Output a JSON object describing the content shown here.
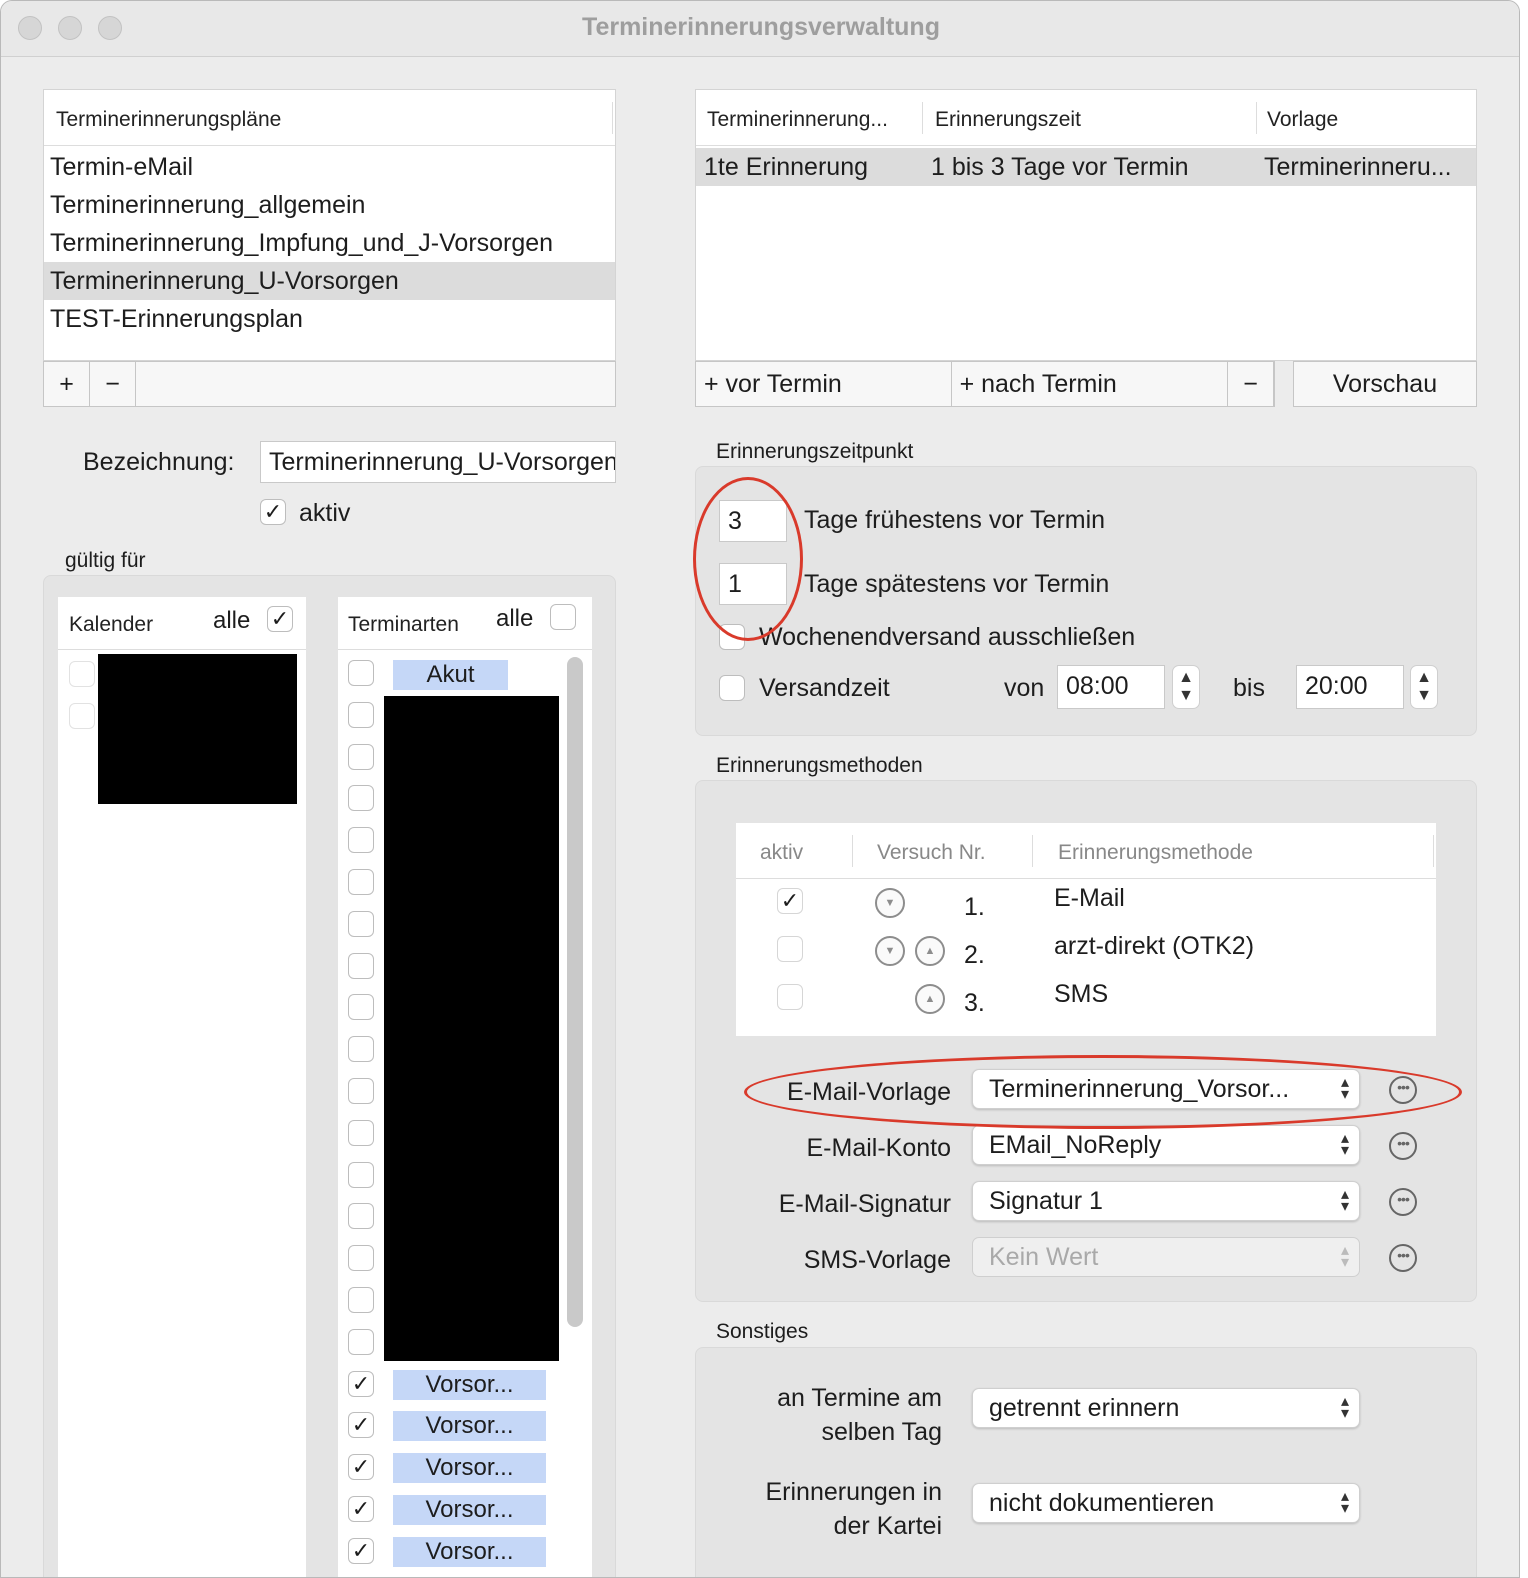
{
  "window": {
    "title": "Terminerinnerungsverwaltung"
  },
  "plans": {
    "header": "Terminerinnerungspläne",
    "items": [
      "Termin-eMail",
      "Terminerinnerung_allgemein",
      "Terminerinnerung_Impfung_und_J-Vorsorgen",
      "Terminerinnerung_U-Vorsorgen",
      "TEST-Erinnerungsplan"
    ],
    "add": "+",
    "remove": "−"
  },
  "name_field": {
    "label": "Bezeichnung:",
    "value": "Terminerinnerung_U-Vorsorgen"
  },
  "active": {
    "label": "aktiv",
    "checked": true
  },
  "valid_for": {
    "label": "gültig für",
    "calendar": {
      "header": "Kalender",
      "all_label": "alle",
      "all_checked": true
    },
    "types": {
      "header": "Terminarten",
      "all_label": "alle",
      "all_checked": false,
      "first_tag": "Akut",
      "checked_tag": "Vorsor..."
    }
  },
  "reminders": {
    "headers": [
      "Terminerinnerung...",
      "Erinnerungszeit",
      "Vorlage"
    ],
    "rows": [
      {
        "name": "1te Erinnerung",
        "time": "1 bis 3 Tage vor Termin",
        "template": "Terminerinneru..."
      }
    ],
    "btn_before": "+ vor Termin",
    "btn_after": "+ nach Termin",
    "btn_remove": "−",
    "btn_preview": "Vorschau"
  },
  "timing": {
    "section": "Erinnerungszeitpunkt",
    "earliest_value": "3",
    "earliest_label": "Tage frühestens vor Termin",
    "latest_value": "1",
    "latest_label": "Tage spätestens vor Termin",
    "weekend_label": "Wochenendversand ausschließen",
    "sendtime_label": "Versandzeit",
    "from_label": "von",
    "from_value": "08:00",
    "to_label": "bis",
    "to_value": "20:00"
  },
  "methods": {
    "section": "Erinnerungsmethoden",
    "headers": [
      "aktiv",
      "Versuch Nr.",
      "Erinnerungsmethode"
    ],
    "rows": [
      {
        "nr": "1.",
        "method": "E-Mail",
        "active": true
      },
      {
        "nr": "2.",
        "method": "arzt-direkt (OTK2)",
        "active": false
      },
      {
        "nr": "3.",
        "method": "SMS",
        "active": false
      }
    ],
    "email_template_label": "E-Mail-Vorlage",
    "email_template_value": "Terminerinnerung_Vorsor...",
    "email_account_label": "E-Mail-Konto",
    "email_account_value": "EMail_NoReply",
    "email_signature_label": "E-Mail-Signatur",
    "email_signature_value": "Signatur 1",
    "sms_template_label": "SMS-Vorlage",
    "sms_template_value": "Kein Wert"
  },
  "misc": {
    "section": "Sonstiges",
    "same_day_label_1": "an Termine am",
    "same_day_label_2": "selben Tag",
    "same_day_value": "getrennt erinnern",
    "record_label_1": "Erinnerungen in",
    "record_label_2": "der Kartei",
    "record_value": "nicht dokumentieren"
  },
  "colors": {
    "annotation": "#d93a2b",
    "tag": "#c5d7f7",
    "selection": "#dcdcdc"
  }
}
